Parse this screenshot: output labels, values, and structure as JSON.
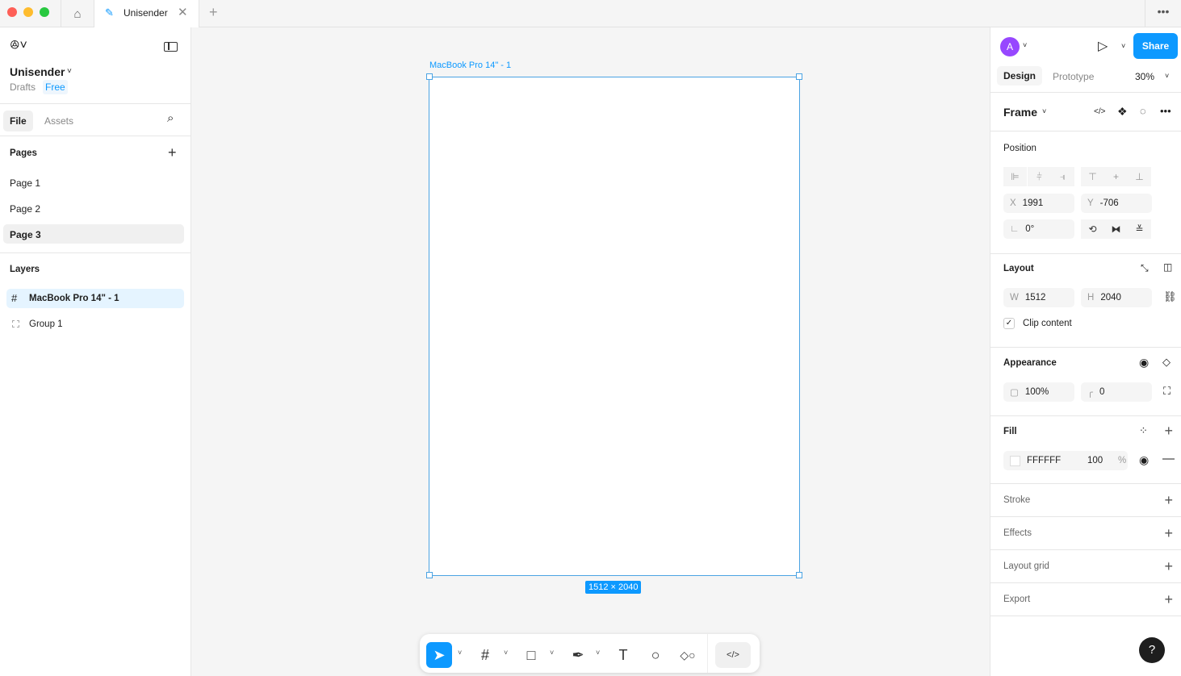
{
  "tabs": {
    "file_tab": "Unisender"
  },
  "file": {
    "name": "Unisender",
    "location": "Drafts",
    "plan": "Free"
  },
  "left_tabs": [
    "File",
    "Assets"
  ],
  "pages": {
    "title": "Pages",
    "items": [
      "Page 1",
      "Page 2",
      "Page 3"
    ],
    "selected": "Page 3"
  },
  "layers": {
    "title": "Layers",
    "items": [
      "MacBook Pro 14\" - 1",
      "Group 1"
    ]
  },
  "canvas": {
    "frame_label": "MacBook Pro 14\" - 1",
    "size_badge": "1512 × 2040"
  },
  "right": {
    "avatar": "A",
    "share": "Share",
    "tabs": [
      "Design",
      "Prototype"
    ],
    "zoom": "30%",
    "frame_type": "Frame",
    "position": {
      "title": "Position",
      "x_label": "X",
      "x": "1991",
      "y_label": "Y",
      "y": "-706",
      "rotation": "0°"
    },
    "layout": {
      "title": "Layout",
      "w_label": "W",
      "w": "1512",
      "h_label": "H",
      "h": "2040",
      "clip": "Clip content"
    },
    "appearance": {
      "title": "Appearance",
      "opacity": "100%",
      "radius": "0"
    },
    "fill": {
      "title": "Fill",
      "hex": "FFFFFF",
      "opacity": "100",
      "unit": "%"
    },
    "stroke": "Stroke",
    "effects": "Effects",
    "layout_grid": "Layout grid",
    "export": "Export"
  },
  "colors": {
    "accent": "#0d99ff",
    "selection": "#4ba3e3",
    "avatar": "#9747ff"
  }
}
